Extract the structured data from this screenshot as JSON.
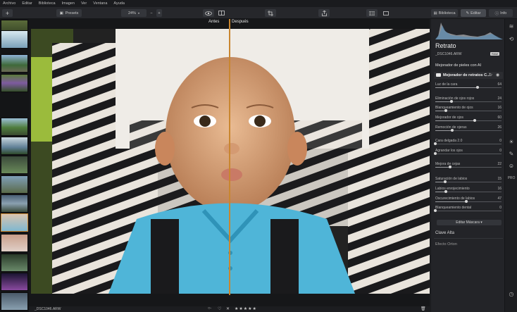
{
  "menu": [
    "Archivo",
    "Editar",
    "Biblioteca",
    "Imagen",
    "Ver",
    "Ventana",
    "Ayuda"
  ],
  "toolbar": {
    "add": "+",
    "presets": "Presets",
    "zoom": "24%",
    "zoom_out": "−",
    "zoom_in": "+"
  },
  "compare": {
    "before": "Antes",
    "after": "Después"
  },
  "tabs": {
    "library": "Biblioteca",
    "editor": "Editar",
    "info": "Info"
  },
  "panel": {
    "title": "Retrato",
    "filename": "_DSC1046.ARW",
    "raw_badge": "RAW",
    "section": "Mejorador de pieles con AI",
    "tool": "Mejorador de retratos C...",
    "mask_button": "Editar Máscara ▾",
    "next1": "Clave Alta",
    "next2": "Efecto Orton"
  },
  "sliders": [
    {
      "label": "Luz de la cara",
      "value": "64",
      "pct": 0.64
    },
    {
      "label": "Eliminación de ojos rojos",
      "value": "24",
      "pct": 0.24
    },
    {
      "label": "Blanqueamiento de ojos",
      "value": "16",
      "pct": 0.16
    },
    {
      "label": "Mejorador de ojos",
      "value": "60",
      "pct": 0.6
    },
    {
      "label": "Remoción de ojeras",
      "value": "26",
      "pct": 0.26
    },
    {
      "label": "Cara delgada 2.0",
      "value": "0",
      "pct": 0
    },
    {
      "label": "Agrandar los ojos",
      "value": "0",
      "pct": 0
    },
    {
      "label": "Mejora de cejas",
      "value": "22",
      "pct": 0.22
    },
    {
      "label": "Saturación de labios",
      "value": "15",
      "pct": 0.15
    },
    {
      "label": "Labios enrojecimiento",
      "value": "16",
      "pct": 0.16
    },
    {
      "label": "Oscurecimiento de labios",
      "value": "47",
      "pct": 0.47
    },
    {
      "label": "Blanqueamiento dental",
      "value": "0",
      "pct": 0
    }
  ],
  "bottom": {
    "filename": "_DSC1046.ARW"
  },
  "colors": {
    "split": "#c9862f",
    "accent": "#c9862f",
    "panel": "#232428"
  }
}
